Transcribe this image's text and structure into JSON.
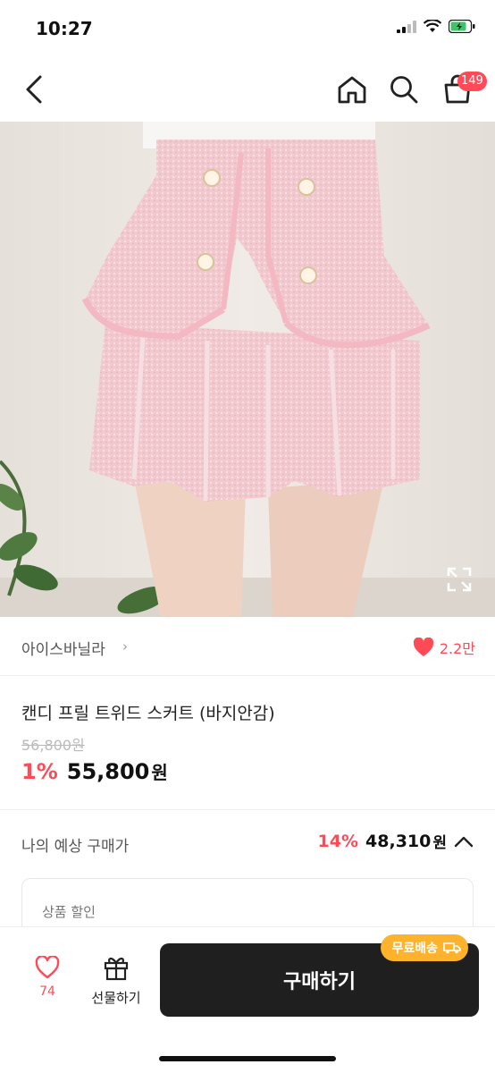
{
  "status": {
    "time": "10:27"
  },
  "nav": {
    "cart_count": "149"
  },
  "brand": {
    "name": "아이스바닐라",
    "chevron": "›",
    "likes": "2.2만"
  },
  "product": {
    "title": "캔디 프릴 트위드 스커트 (바지안감)",
    "original_price": "56,800원",
    "discount": "1%",
    "price": "55,800",
    "price_unit": "원"
  },
  "expected": {
    "label": "나의 예상 구매가",
    "discount": "14%",
    "price": "48,310",
    "unit": "원"
  },
  "discount_card": {
    "label": "상품 할인"
  },
  "bottom": {
    "wish_count": "74",
    "gift_label": "선물하기",
    "buy_label": "구매하기",
    "free_shipping": "무료배송"
  },
  "colors": {
    "accent": "#ff4a57",
    "buy_bg": "#1f1f1f",
    "badge_orange": "#ffb22b"
  }
}
